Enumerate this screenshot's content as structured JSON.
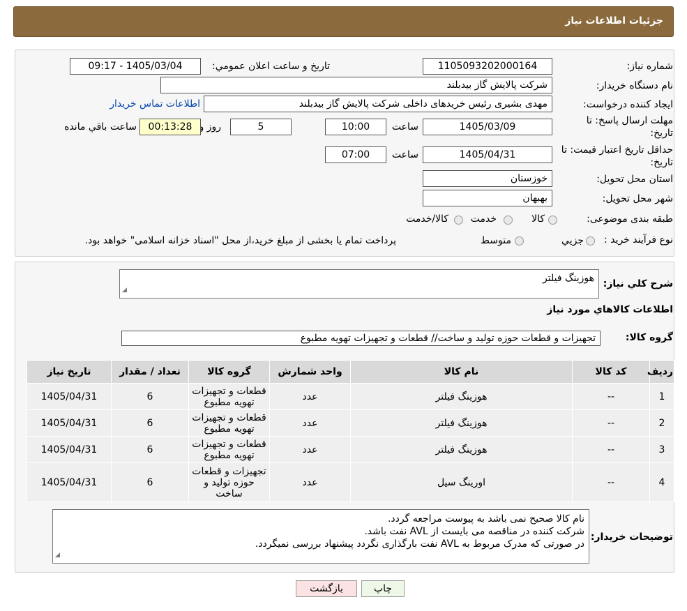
{
  "header": {
    "title": "جزئیات اطلاعات نیاز"
  },
  "fields": {
    "need_number_label": "شماره نیاز:",
    "need_number": "1105093202000164",
    "announce_label": "تاریخ و ساعت اعلان عمومي:",
    "announce_value": "1405/03/04 - 09:17",
    "buyer_org_label": "نام دستگاه خریدار:",
    "buyer_org": "شرکت پالایش گاز بیدبلند",
    "creator_label": "ایجاد کننده درخواست:",
    "creator": "مهدی بشیری رئیس خریدهای داخلی شرکت پالایش گاز بیدبلند",
    "contact_link": "اطلاعات تماس خریدار",
    "deadline_label_1": "مهلت ارسال پاسخ: تا",
    "deadline_label_2": "تاریخ:",
    "deadline_date": "1405/03/09",
    "time_label": "ساعت",
    "deadline_time": "10:00",
    "days_value": "5",
    "days_label": "روز و",
    "remaining_time": "00:13:28",
    "remaining_label": "ساعت باقي مانده",
    "validity_label_1": "حداقل تاریخ اعتبار قیمت: تا",
    "validity_label_2": "تاریخ:",
    "validity_date": "1405/04/31",
    "validity_time": "07:00",
    "province_label": "استان محل تحویل:",
    "province": "خوزستان",
    "city_label": "شهر محل تحویل:",
    "city": "بهبهان",
    "category_label": "طبقه بندی موضوعی:",
    "category_options": [
      "کالا",
      "خدمت",
      "کالا/خدمت"
    ],
    "process_label": "نوع فرآیند خرید :",
    "process_options": [
      "جزیي",
      "متوسط"
    ],
    "process_note": "پرداخت تمام یا بخشی از مبلغ خرید،از محل \"اسناد خزانه اسلامی\" خواهد بود."
  },
  "details": {
    "summary_label": "شرح کلي نیاز:",
    "summary": "هوزینگ فیلتر",
    "goods_info_title": "اطلاعات کالاهاي مورد نیاز",
    "group_label": "گروه کالا:",
    "group_value": "تجهیزات و قطعات حوزه تولید و ساخت//  قطعات و تجهیزات تهویه مطبوع"
  },
  "table": {
    "headers": [
      "ردیف",
      "کد کالا",
      "نام کالا",
      "واحد شمارش",
      "گروه کالا",
      "تعداد / مقدار",
      "تاریخ نیاز"
    ],
    "rows": [
      [
        "1",
        "--",
        "هوزینگ فیلتر",
        "عدد",
        "قطعات و تجهیزات تهویه مطبوع",
        "6",
        "1405/04/31"
      ],
      [
        "2",
        "--",
        "هوزینگ فیلتر",
        "عدد",
        "قطعات و تجهیزات تهویه مطبوع",
        "6",
        "1405/04/31"
      ],
      [
        "3",
        "--",
        "هوزینگ فیلتر",
        "عدد",
        "قطعات و تجهیزات تهویه مطبوع",
        "6",
        "1405/04/31"
      ],
      [
        "4",
        "--",
        "اورینگ سیل",
        "عدد",
        "تجهیزات و قطعات حوزه تولید و ساخت",
        "6",
        "1405/04/31"
      ]
    ]
  },
  "buyer_notes": {
    "label": "توضیحات خریدار:",
    "lines": [
      "نام کالا صحیح نمی باشد به پیوست مراجعه گردد.",
      "شرکت کننده در مناقصه می بایست از AVL نفت باشد.",
      "در صورتی که مدرک مربوط به AVL نفت بارگذاری نگردد پیشنهاد بررسی نمیگردد."
    ]
  },
  "buttons": {
    "print": "چاپ",
    "back": "بازگشت"
  },
  "colors": {
    "header": "#8b6b3d",
    "link": "#0645ad",
    "remaining_bg": "#ffffcc"
  }
}
